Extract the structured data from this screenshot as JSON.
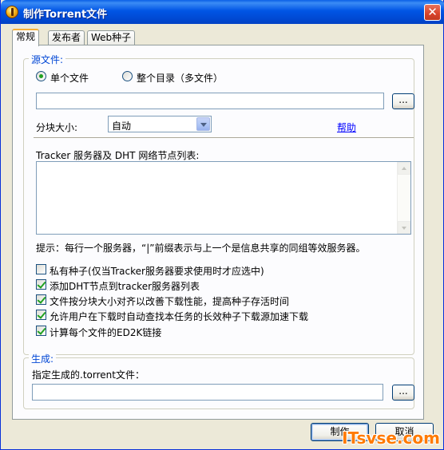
{
  "window": {
    "title": "制作Torrent文件",
    "close_glyph": "✕"
  },
  "tabs": [
    {
      "label": "常规",
      "active": true
    },
    {
      "label": "发布者",
      "active": false
    },
    {
      "label": "Web种子",
      "active": false
    }
  ],
  "source": {
    "legend": "源文件:",
    "radio_single": "单个文件",
    "radio_directory": "整个目录（多文件）",
    "path_value": "",
    "browse_label": "...",
    "piece_size_label": "分块大小:",
    "piece_size_value": "自动",
    "help_link": "帮助",
    "trackers_label": "Tracker 服务器及 DHT 网络节点列表:",
    "trackers_value": "",
    "hint": "提示：每行一个服务器，“|”前缀表示与上一个是信息共享的同组等效服务器。"
  },
  "options": [
    {
      "label": "私有种子(仅当Tracker服务器要求使用时才应选中)",
      "checked": false
    },
    {
      "label": "添加DHT节点到tracker服务器列表",
      "checked": true
    },
    {
      "label": "文件按分块大小对齐以改善下载性能，提高种子存活时间",
      "checked": true
    },
    {
      "label": "允许用户在下载时自动查找本任务的长效种子下载源加速下载",
      "checked": true
    },
    {
      "label": "计算每个文件的ED2K链接",
      "checked": true
    }
  ],
  "output": {
    "legend": "生成:",
    "target_label": "指定生成的.torrent文件：",
    "target_value": "",
    "browse_label": "..."
  },
  "buttons": {
    "make": "制作",
    "cancel": "取消"
  },
  "watermark": "ITsvse.com",
  "colors": {
    "titlebar": "#0055e5",
    "legend_text": "#0046d5",
    "link": "#0000ff",
    "check": "#21a121",
    "watermark": "#ff7a00"
  }
}
